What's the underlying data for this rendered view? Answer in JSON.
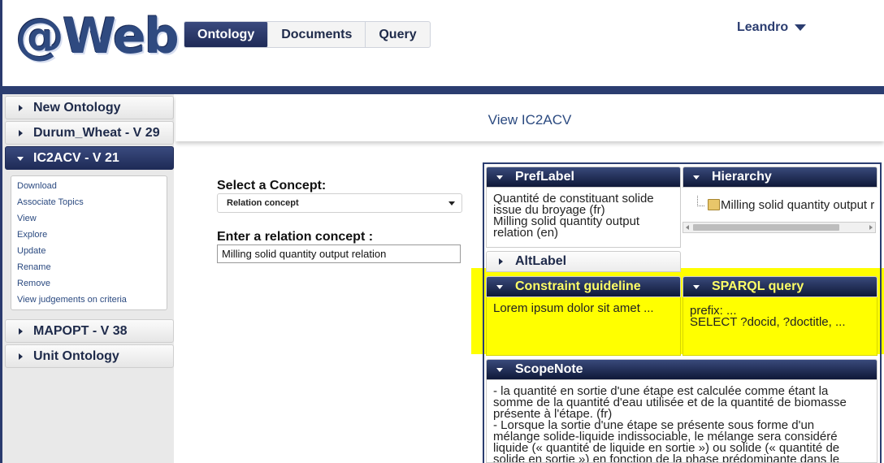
{
  "header": {
    "logo": "@Web",
    "nav": [
      "Ontology",
      "Documents",
      "Query"
    ],
    "user": "Leandro"
  },
  "sidebar": {
    "items": [
      {
        "label": "New Ontology"
      },
      {
        "label": "Durum_Wheat - V 29"
      },
      {
        "label": "IC2ACV - V 21"
      },
      {
        "label": "MAPOPT - V 38"
      },
      {
        "label": "Unit Ontology"
      }
    ],
    "submenu": [
      "Download",
      "Associate Topics",
      "View",
      "Explore",
      "Update",
      "Rename",
      "Remove",
      "View judgements on criteria"
    ]
  },
  "main": {
    "title": "View IC2ACV",
    "select_concept_label": "Select a Concept:",
    "select_value": "Relation concept",
    "relation_label": "Enter a relation concept :",
    "relation_value": "Milling solid quantity output relation"
  },
  "panels": {
    "preflabel": {
      "title": "PrefLabel",
      "lines": [
        "Quantité de constituant solide",
        "issue du broyage (fr)",
        "Milling solid quantity output",
        "relation (en)"
      ]
    },
    "hierarchy": {
      "title": "Hierarchy",
      "node": "Milling solid quantity output r"
    },
    "altlabel": {
      "title": "AltLabel"
    },
    "constraint": {
      "title": "Constraint guideline",
      "text": "Lorem ipsum dolor sit amet ..."
    },
    "sparql": {
      "title": "SPARQL query",
      "lines": [
        "prefix: ...",
        "SELECT ?docid, ?doctitle, ..."
      ]
    },
    "scopenote": {
      "title": "ScopeNote",
      "lines": [
        "- la quantité en sortie d'une étape est calculée comme étant la",
        "somme de la quantité d'eau utilisée et de la quantité de biomasse",
        "présente à l'étape. (fr)",
        "- Lorsque la sortie d'une étape se présente sous forme d'un",
        "mélange solide-liquide indissociable, le mélange sera considéré",
        "liquide (« quantité de liquide en sortie ») ou solide (« quantité de",
        "solide en sortie ») en fonction de la phase prédominante dans le"
      ]
    }
  },
  "colors": {
    "brand": "#2b3d70",
    "highlight": "#ffff00",
    "link": "#2b4a80"
  }
}
